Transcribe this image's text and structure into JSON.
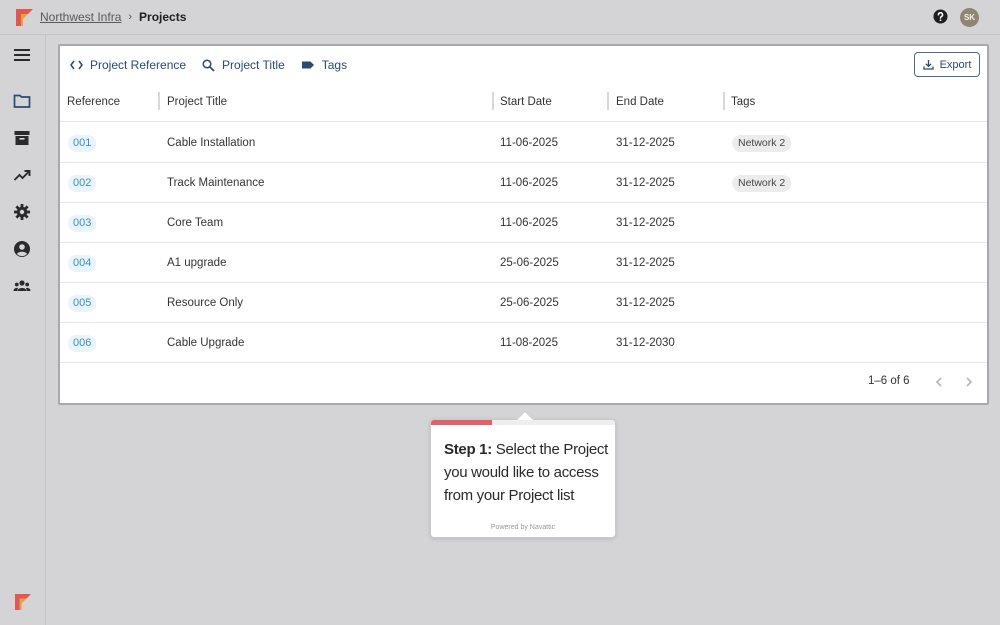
{
  "header": {
    "org_link": "Northwest Infra",
    "separator": "›",
    "current_page": "Projects",
    "avatar_initials": "SK",
    "icons": {
      "help": "help-circle-icon",
      "logo": "brand-logo-icon"
    }
  },
  "sidebar": {
    "items": [
      {
        "icon": "menu-icon"
      },
      {
        "icon": "folder-icon"
      },
      {
        "icon": "archive-icon"
      },
      {
        "icon": "trending-up-icon"
      },
      {
        "icon": "gear-icon"
      },
      {
        "icon": "account-circle-icon"
      },
      {
        "icon": "groups-icon"
      }
    ]
  },
  "toolbar": {
    "filters": [
      {
        "label": "Project Reference",
        "icon": "code-icon"
      },
      {
        "label": "Project Title",
        "icon": "search-icon"
      },
      {
        "label": "Tags",
        "icon": "tag-icon"
      }
    ],
    "export_label": "Export"
  },
  "table": {
    "columns": [
      "Reference",
      "Project Title",
      "Start Date",
      "End Date",
      "Tags"
    ],
    "rows": [
      {
        "ref": "001",
        "title": "Cable Installation",
        "start": "11-06-2025",
        "end": "31-12-2025",
        "tag": "Network 2"
      },
      {
        "ref": "002",
        "title": "Track Maintenance",
        "start": "11-06-2025",
        "end": "31-12-2025",
        "tag": "Network 2"
      },
      {
        "ref": "003",
        "title": "Core Team",
        "start": "11-06-2025",
        "end": "31-12-2025",
        "tag": ""
      },
      {
        "ref": "004",
        "title": "A1 upgrade",
        "start": "25-06-2025",
        "end": "31-12-2025",
        "tag": ""
      },
      {
        "ref": "005",
        "title": "Resource Only",
        "start": "25-06-2025",
        "end": "31-12-2025",
        "tag": ""
      },
      {
        "ref": "006",
        "title": "Cable Upgrade",
        "start": "11-08-2025",
        "end": "31-12-2030",
        "tag": ""
      }
    ]
  },
  "pagination": {
    "range": "1–6 of 6"
  },
  "tooltip": {
    "step_label": "Step 1:",
    "text": "Select the Project you would like to access from your Project list",
    "powered_by": "Powered by Navattic",
    "progress": 0.33
  },
  "colors": {
    "accent": "#2c4a6e",
    "ref_chip": "#3a8fc8",
    "progress": "#e0616b",
    "brand_red": "#e0584f"
  }
}
